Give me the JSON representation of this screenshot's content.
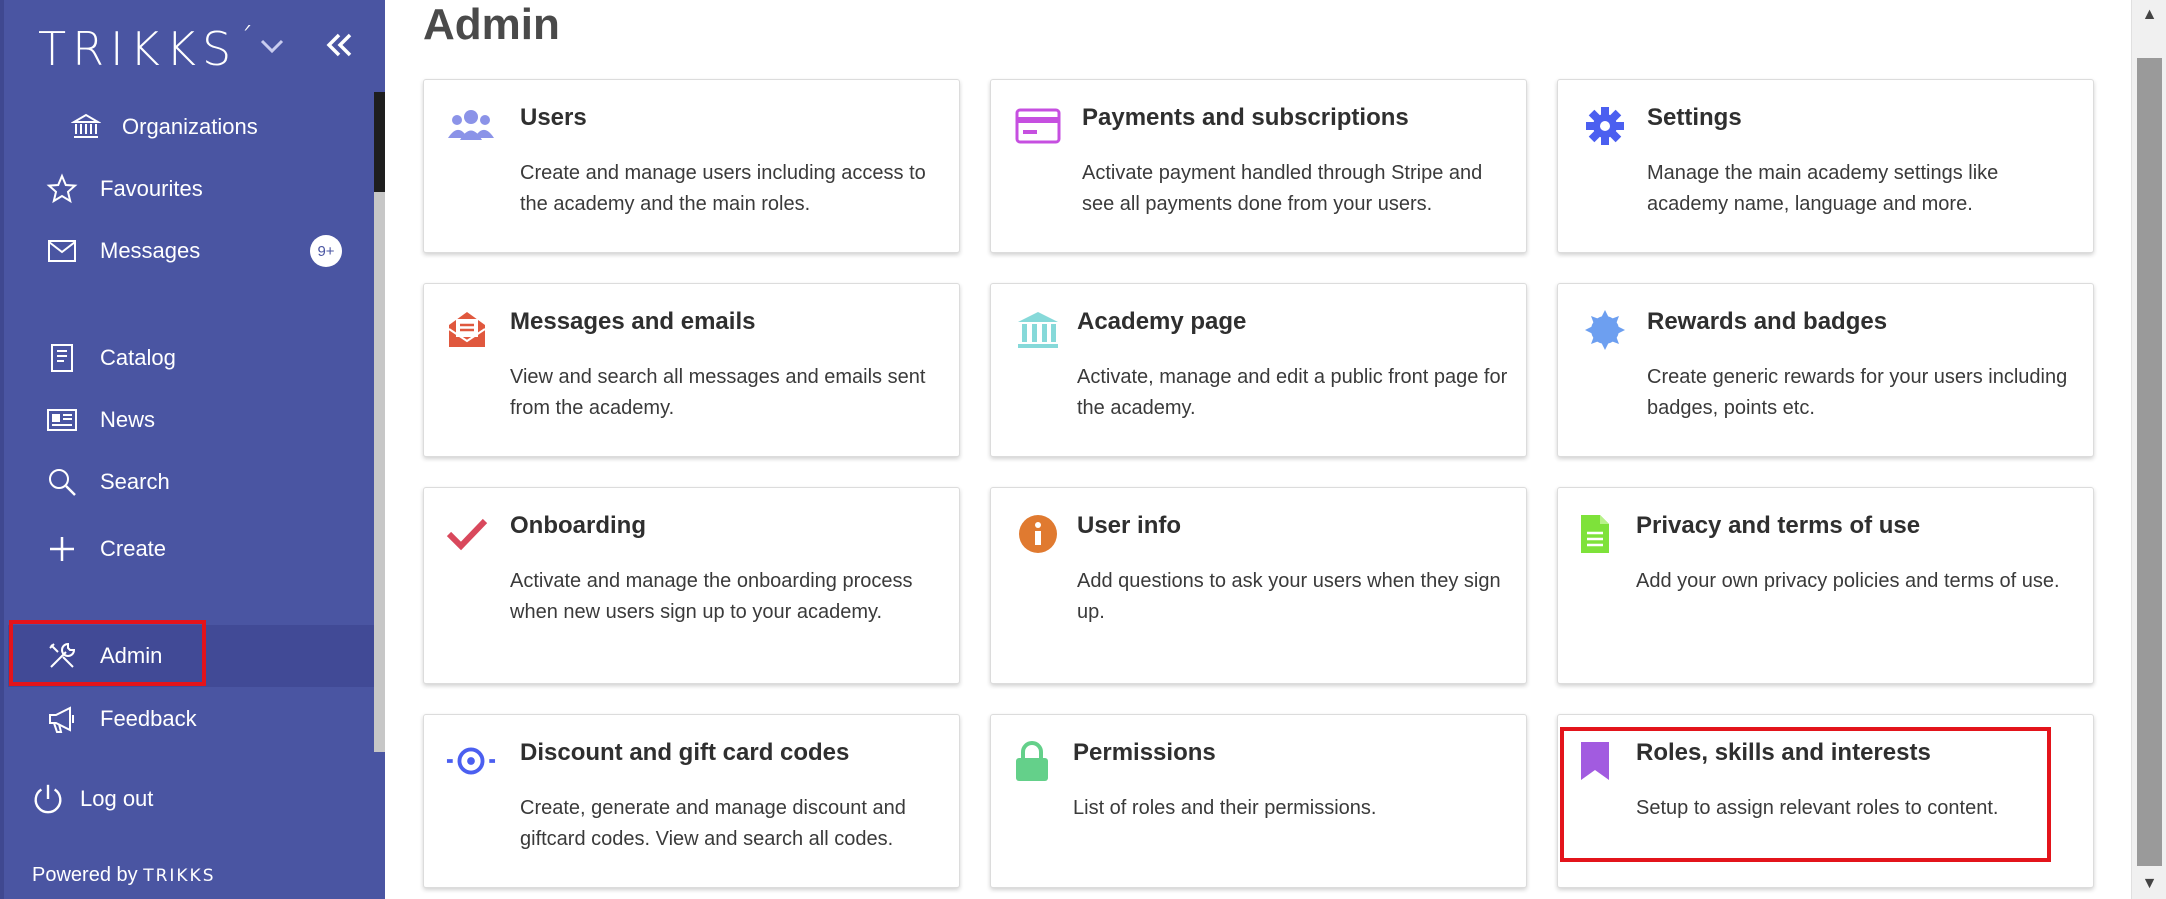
{
  "sidebar": {
    "logo_text": "TRIKKS",
    "items": [
      {
        "label": "Organizations"
      },
      {
        "label": "Favourites"
      },
      {
        "label": "Messages",
        "badge": "9+"
      },
      {
        "label": "Catalog"
      },
      {
        "label": "News"
      },
      {
        "label": "Search"
      },
      {
        "label": "Create"
      },
      {
        "label": "Admin"
      },
      {
        "label": "Feedback"
      },
      {
        "label": "Log out"
      }
    ],
    "powered_label": "Powered by",
    "powered_brand": "TRIKKS"
  },
  "main": {
    "title": "Admin",
    "cards": [
      {
        "title": "Users",
        "desc": "Create and manage users including access to the academy and the main roles.",
        "icon": "users-icon",
        "color": "#8b93e8"
      },
      {
        "title": "Payments and subscriptions",
        "desc": "Activate payment handled through Stripe and see all payments done from your users.",
        "icon": "credit-card-icon",
        "color": "#c64fe0"
      },
      {
        "title": "Settings",
        "desc": "Manage the main academy settings like academy name, language and more.",
        "icon": "gear-icon",
        "color": "#4b5ff0"
      },
      {
        "title": "Messages and emails",
        "desc": "View and search all messages and emails sent from the academy.",
        "icon": "envelope-open-icon",
        "color": "#e0583e"
      },
      {
        "title": "Academy page",
        "desc": "Activate, manage and edit a public front page for the academy.",
        "icon": "landmark-icon",
        "color": "#86d9d9"
      },
      {
        "title": "Rewards and badges",
        "desc": "Create generic rewards for your users including badges, points etc.",
        "icon": "certificate-icon",
        "color": "#6d9ff0"
      },
      {
        "title": "Onboarding",
        "desc": "Activate and manage the onboarding process when new users sign up to your academy.",
        "icon": "checkmark-icon",
        "color": "#d9485c"
      },
      {
        "title": "User info",
        "desc": "Add questions to ask your users when they sign up.",
        "icon": "info-circle-icon",
        "color": "#e07a30"
      },
      {
        "title": "Privacy and terms of use",
        "desc": "Add your own privacy policies and terms of use.",
        "icon": "document-icon",
        "color": "#7ee23a"
      },
      {
        "title": "Discount and gift card codes",
        "desc": "Create, generate and manage discount and giftcard codes. View and search all codes.",
        "icon": "discount-code-icon",
        "color": "#4b5ff0"
      },
      {
        "title": "Permissions",
        "desc": "List of roles and their permissions.",
        "icon": "lock-icon",
        "color": "#64d08a"
      },
      {
        "title": "Roles, skills and interests",
        "desc": "Setup to assign relevant roles to content.",
        "icon": "bookmark-icon",
        "color": "#a25be0"
      }
    ]
  }
}
